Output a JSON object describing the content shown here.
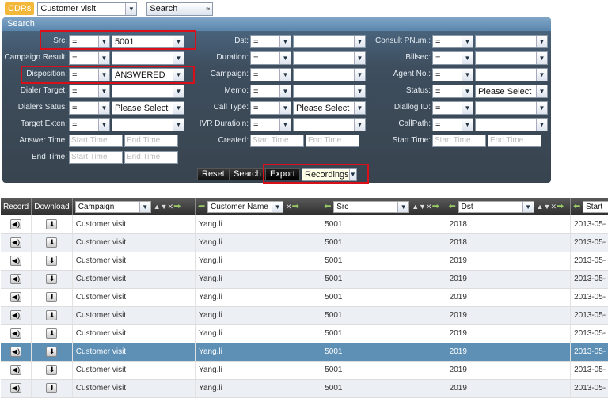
{
  "topbar": {
    "tag": "CDRs",
    "module": "Customer visit",
    "search_btn": "Search"
  },
  "panel": {
    "title": "Search"
  },
  "fields": {
    "src": {
      "label": "Src:",
      "op": "=",
      "value": "5001"
    },
    "dst": {
      "label": "Dst:",
      "op": "=",
      "value": ""
    },
    "consult": {
      "label": "Consult PNum.:",
      "op": "=",
      "value": ""
    },
    "campaign_result": {
      "label": "Campaign Result:",
      "op": "=",
      "value": ""
    },
    "duration": {
      "label": "Duration:",
      "op": "=",
      "value": ""
    },
    "billsec": {
      "label": "Billsec:",
      "op": "=",
      "value": ""
    },
    "disposition": {
      "label": "Disposition:",
      "op": "=",
      "value": "ANSWERED"
    },
    "campaign": {
      "label": "Campaign:",
      "op": "=",
      "value": ""
    },
    "agent": {
      "label": "Agent No.:",
      "op": "=",
      "value": ""
    },
    "dialer_target": {
      "label": "Dialer Target:",
      "op": "=",
      "value": ""
    },
    "memo": {
      "label": "Memo:",
      "op": "=",
      "value": ""
    },
    "status": {
      "label": "Status:",
      "op": "=",
      "value": "Please Select"
    },
    "dialers_status": {
      "label": "Dialers Satus:",
      "op": "=",
      "value": "Please Select"
    },
    "call_type": {
      "label": "Call Type:",
      "op": "=",
      "value": "Please Select"
    },
    "dialog_id": {
      "label": "Diallog ID:",
      "op": "=",
      "value": ""
    },
    "target_exten": {
      "label": "Target Exten:",
      "op": "=",
      "value": ""
    },
    "ivr_duration": {
      "label": "IVR Duratioin:",
      "op": "=",
      "value": ""
    },
    "callpath": {
      "label": "CallPath:",
      "op": "=",
      "value": ""
    },
    "answer_time": {
      "label": "Answer Time:",
      "start": "Start Time",
      "end": "End Time"
    },
    "created": {
      "label": "Created:",
      "start": "Start Time",
      "end": "End Time"
    },
    "start_time": {
      "label": "Start Time:",
      "start": "Start Time",
      "end": "End Time"
    },
    "end_time": {
      "label": "End Time:",
      "start": "Start Time",
      "end": "End Time"
    }
  },
  "buttons": {
    "reset": "Reset",
    "search": "Search",
    "export": "Export",
    "recordings": "Recordings"
  },
  "table": {
    "headers": {
      "record": "Record",
      "download": "Download",
      "campaign": "Campaign",
      "customer": "Customer Name",
      "src": "Src",
      "dst": "Dst",
      "start": "Start"
    },
    "rows": [
      {
        "campaign": "Customer visit",
        "customer": "Yang.li",
        "src": "5001",
        "dst": "2018",
        "start": "2013-05-"
      },
      {
        "campaign": "Customer visit",
        "customer": "Yang.li",
        "src": "5001",
        "dst": "2018",
        "start": "2013-05-"
      },
      {
        "campaign": "Customer visit",
        "customer": "Yang.li",
        "src": "5001",
        "dst": "2019",
        "start": "2013-05-"
      },
      {
        "campaign": "Customer visit",
        "customer": "Yang.li",
        "src": "5001",
        "dst": "2019",
        "start": "2013-05-"
      },
      {
        "campaign": "Customer visit",
        "customer": "Yang.li",
        "src": "5001",
        "dst": "2019",
        "start": "2013-05-"
      },
      {
        "campaign": "Customer visit",
        "customer": "Yang.li",
        "src": "5001",
        "dst": "2019",
        "start": "2013-05-"
      },
      {
        "campaign": "Customer visit",
        "customer": "Yang.li",
        "src": "5001",
        "dst": "2019",
        "start": "2013-05-"
      },
      {
        "campaign": "Customer visit",
        "customer": "Yang.li",
        "src": "5001",
        "dst": "2019",
        "start": "2013-05-"
      },
      {
        "campaign": "Customer visit",
        "customer": "Yang.li",
        "src": "5001",
        "dst": "2019",
        "start": "2013-05-"
      },
      {
        "campaign": "Customer visit",
        "customer": "Yang.li",
        "src": "5001",
        "dst": "2019",
        "start": "2013-05-"
      }
    ]
  },
  "colors": {
    "highlight": "#d9101a",
    "panel": "#3e4e5e",
    "selected_row": "#5e8fb5"
  }
}
